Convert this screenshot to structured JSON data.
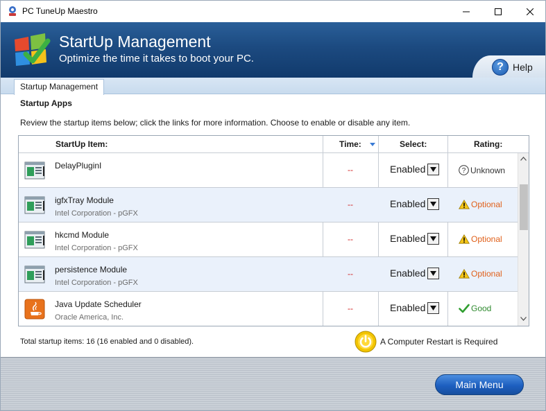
{
  "window": {
    "title": "PC TuneUp Maestro"
  },
  "header": {
    "title": "StartUp Management",
    "subtitle": "Optimize the time it takes to boot your PC.",
    "help_label": "Help"
  },
  "tabs": [
    {
      "label": "Startup Management"
    }
  ],
  "section": {
    "title": "Startup Apps",
    "description": "Review the startup items below; click the links for more information. Choose to enable or disable any item."
  },
  "table": {
    "headers": {
      "item": "StartUp Item:",
      "time": "Time:",
      "select": "Select:",
      "rating": "Rating:"
    },
    "rows": [
      {
        "name": "DelayPluginI",
        "publisher": "",
        "time": "--",
        "status": "Enabled",
        "rating": "Unknown",
        "rating_icon": "question-icon",
        "rating_color": "#333333",
        "icon": "app-window-icon"
      },
      {
        "name": "igfxTray Module",
        "publisher": "Intel Corporation - pGFX",
        "time": "--",
        "status": "Enabled",
        "rating": "Optional",
        "rating_icon": "warning-icon",
        "rating_color": "#e0601a",
        "icon": "app-window-icon"
      },
      {
        "name": "hkcmd Module",
        "publisher": "Intel Corporation - pGFX",
        "time": "--",
        "status": "Enabled",
        "rating": "Optional",
        "rating_icon": "warning-icon",
        "rating_color": "#e0601a",
        "icon": "app-window-icon"
      },
      {
        "name": "persistence Module",
        "publisher": "Intel Corporation - pGFX",
        "time": "--",
        "status": "Enabled",
        "rating": "Optional",
        "rating_icon": "warning-icon",
        "rating_color": "#e0601a",
        "icon": "app-window-icon"
      },
      {
        "name": "Java Update Scheduler",
        "publisher": "Oracle America, Inc.",
        "time": "--",
        "status": "Enabled",
        "rating": "Good",
        "rating_icon": "check-icon",
        "rating_color": "#2f8a2f",
        "icon": "java-icon"
      }
    ]
  },
  "footer": {
    "total": "Total startup items: 16 (16 enabled and 0 disabled).",
    "restart": "A Computer Restart is Required",
    "main_menu": "Main Menu"
  },
  "colors": {
    "header_blue": "#1c4a80",
    "accent_button": "#1d5fc0",
    "time_red": "#d02020"
  }
}
